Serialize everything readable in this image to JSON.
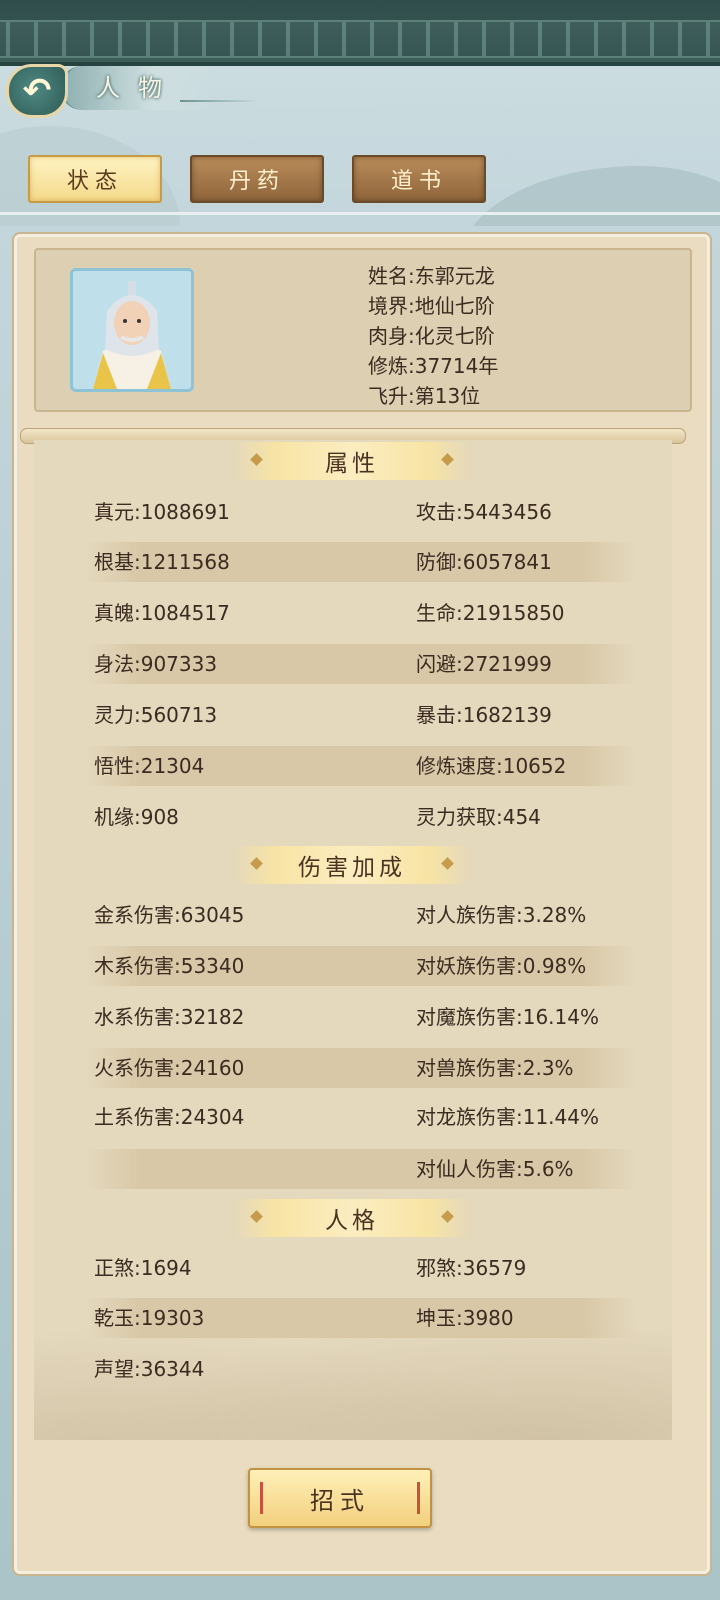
{
  "header": {
    "title": "人物"
  },
  "tabs": [
    {
      "label": "状态",
      "active": true
    },
    {
      "label": "丹药",
      "active": false
    },
    {
      "label": "道书",
      "active": false
    }
  ],
  "profile": {
    "name": "姓名:东郭元龙",
    "realm": "境界:地仙七阶",
    "body": "肉身:化灵七阶",
    "cultivation": "修炼:37714年",
    "ascension": "飞升:第13位"
  },
  "sections": {
    "attributes": {
      "title": "属性",
      "rows": [
        [
          "真元:1088691",
          "攻击:5443456"
        ],
        [
          "根基:1211568",
          "防御:6057841"
        ],
        [
          "真魄:1084517",
          "生命:21915850"
        ],
        [
          "身法:907333",
          "闪避:2721999"
        ],
        [
          "灵力:560713",
          "暴击:1682139"
        ],
        [
          "悟性:21304",
          "修炼速度:10652"
        ],
        [
          "机缘:908",
          "灵力获取:454"
        ]
      ]
    },
    "damage": {
      "title": "伤害加成",
      "rows": [
        [
          "金系伤害:63045",
          "对人族伤害:3.28%"
        ],
        [
          "木系伤害:53340",
          "对妖族伤害:0.98%"
        ],
        [
          "水系伤害:32182",
          "对魔族伤害:16.14%"
        ],
        [
          "火系伤害:24160",
          "对兽族伤害:2.3%"
        ],
        [
          "土系伤害:24304",
          "对龙族伤害:11.44%"
        ],
        [
          "",
          "对仙人伤害:5.6%"
        ]
      ]
    },
    "personality": {
      "title": "人格",
      "rows": [
        [
          "正煞:1694",
          "邪煞:36579"
        ],
        [
          "乾玉:19303",
          "坤玉:3980"
        ],
        [
          "声望:36344",
          ""
        ]
      ]
    }
  },
  "footer": {
    "skill_button": "招式"
  }
}
